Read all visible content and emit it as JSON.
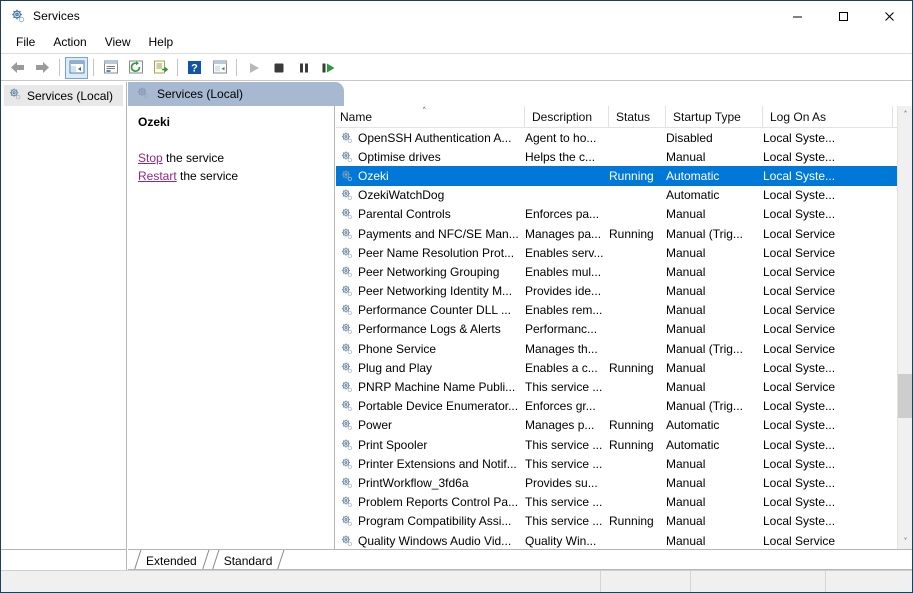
{
  "window": {
    "title": "Services",
    "icon": "services-gear-icon",
    "controls": {
      "minimize": "—",
      "maximize": "☐",
      "close": "✕"
    }
  },
  "menubar": {
    "items": [
      {
        "label": "File",
        "name": "menu-file"
      },
      {
        "label": "Action",
        "name": "menu-action"
      },
      {
        "label": "View",
        "name": "menu-view"
      },
      {
        "label": "Help",
        "name": "menu-help"
      }
    ]
  },
  "toolbar": {
    "buttons": [
      {
        "name": "back-arrow-icon",
        "glyph": "←"
      },
      {
        "name": "forward-arrow-icon",
        "glyph": "→"
      },
      {
        "name": "show-hide-tree-icon",
        "glyph": "▤"
      },
      {
        "name": "properties-icon",
        "glyph": "▤"
      },
      {
        "name": "refresh-icon",
        "glyph": "↻"
      },
      {
        "name": "export-list-icon",
        "glyph": "↳"
      },
      {
        "name": "help-icon",
        "glyph": "?"
      },
      {
        "name": "new-window-icon",
        "glyph": "▤"
      },
      {
        "name": "start-service-icon",
        "glyph": "▶"
      },
      {
        "name": "stop-service-icon",
        "glyph": "■"
      },
      {
        "name": "pause-service-icon",
        "glyph": "‖"
      },
      {
        "name": "restart-service-icon",
        "glyph": "▶"
      }
    ]
  },
  "tree": {
    "root_label": "Services (Local)"
  },
  "pane": {
    "header_label": "Services (Local)"
  },
  "details": {
    "service_name": "Ozeki",
    "actions": [
      {
        "link": "Stop",
        "rest": " the service"
      },
      {
        "link": "Restart",
        "rest": " the service"
      }
    ]
  },
  "list": {
    "columns": [
      {
        "label": "Name",
        "name": "column-header-name",
        "sorted": true,
        "sort_caret": "˄"
      },
      {
        "label": "Description",
        "name": "column-header-description"
      },
      {
        "label": "Status",
        "name": "column-header-status"
      },
      {
        "label": "Startup Type",
        "name": "column-header-startup-type"
      },
      {
        "label": "Log On As",
        "name": "column-header-log-on-as"
      }
    ],
    "rows": [
      {
        "name": "OpenSSH Authentication A...",
        "description": "Agent to ho...",
        "status": "",
        "startup": "Disabled",
        "logon": "Local Syste...",
        "selected": false
      },
      {
        "name": "Optimise drives",
        "description": "Helps the c...",
        "status": "",
        "startup": "Manual",
        "logon": "Local Syste...",
        "selected": false
      },
      {
        "name": "Ozeki",
        "description": "",
        "status": "Running",
        "startup": "Automatic",
        "logon": "Local Syste...",
        "selected": true
      },
      {
        "name": "OzekiWatchDog",
        "description": "",
        "status": "",
        "startup": "Automatic",
        "logon": "Local Syste...",
        "selected": false
      },
      {
        "name": "Parental Controls",
        "description": "Enforces pa...",
        "status": "",
        "startup": "Manual",
        "logon": "Local Syste...",
        "selected": false
      },
      {
        "name": "Payments and NFC/SE Man...",
        "description": "Manages pa...",
        "status": "Running",
        "startup": "Manual (Trig...",
        "logon": "Local Service",
        "selected": false
      },
      {
        "name": "Peer Name Resolution Prot...",
        "description": "Enables serv...",
        "status": "",
        "startup": "Manual",
        "logon": "Local Service",
        "selected": false
      },
      {
        "name": "Peer Networking Grouping",
        "description": "Enables mul...",
        "status": "",
        "startup": "Manual",
        "logon": "Local Service",
        "selected": false
      },
      {
        "name": "Peer Networking Identity M...",
        "description": "Provides ide...",
        "status": "",
        "startup": "Manual",
        "logon": "Local Service",
        "selected": false
      },
      {
        "name": "Performance Counter DLL ...",
        "description": "Enables rem...",
        "status": "",
        "startup": "Manual",
        "logon": "Local Service",
        "selected": false
      },
      {
        "name": "Performance Logs & Alerts",
        "description": "Performanc...",
        "status": "",
        "startup": "Manual",
        "logon": "Local Service",
        "selected": false
      },
      {
        "name": "Phone Service",
        "description": "Manages th...",
        "status": "",
        "startup": "Manual (Trig...",
        "logon": "Local Service",
        "selected": false
      },
      {
        "name": "Plug and Play",
        "description": "Enables a c...",
        "status": "Running",
        "startup": "Manual",
        "logon": "Local Syste...",
        "selected": false
      },
      {
        "name": "PNRP Machine Name Publi...",
        "description": "This service ...",
        "status": "",
        "startup": "Manual",
        "logon": "Local Service",
        "selected": false
      },
      {
        "name": "Portable Device Enumerator...",
        "description": "Enforces gr...",
        "status": "",
        "startup": "Manual (Trig...",
        "logon": "Local Syste...",
        "selected": false
      },
      {
        "name": "Power",
        "description": "Manages p...",
        "status": "Running",
        "startup": "Automatic",
        "logon": "Local Syste...",
        "selected": false
      },
      {
        "name": "Print Spooler",
        "description": "This service ...",
        "status": "Running",
        "startup": "Automatic",
        "logon": "Local Syste...",
        "selected": false
      },
      {
        "name": "Printer Extensions and Notif...",
        "description": "This service ...",
        "status": "",
        "startup": "Manual",
        "logon": "Local Syste...",
        "selected": false
      },
      {
        "name": "PrintWorkflow_3fd6a",
        "description": "Provides su...",
        "status": "",
        "startup": "Manual",
        "logon": "Local Syste...",
        "selected": false
      },
      {
        "name": "Problem Reports Control Pa...",
        "description": "This service ...",
        "status": "",
        "startup": "Manual",
        "logon": "Local Syste...",
        "selected": false
      },
      {
        "name": "Program Compatibility Assi...",
        "description": "This service ...",
        "status": "Running",
        "startup": "Manual",
        "logon": "Local Syste...",
        "selected": false
      },
      {
        "name": "Quality Windows Audio Vid...",
        "description": "Quality Win...",
        "status": "",
        "startup": "Manual",
        "logon": "Local Service",
        "selected": false
      }
    ]
  },
  "scrollbar": {
    "up_arrow": "˄",
    "down_arrow": "˅"
  },
  "tabs": [
    {
      "label": "Extended",
      "name": "tab-extended",
      "active": false
    },
    {
      "label": "Standard",
      "name": "tab-standard",
      "active": true
    }
  ],
  "statusbar": {
    "panes": [
      "",
      "",
      "",
      ""
    ]
  },
  "colors": {
    "selection": "#0078d7",
    "pane_header": "#a7b8d1",
    "link": "#8a2a8a",
    "window_border": "#1d3f5e"
  }
}
